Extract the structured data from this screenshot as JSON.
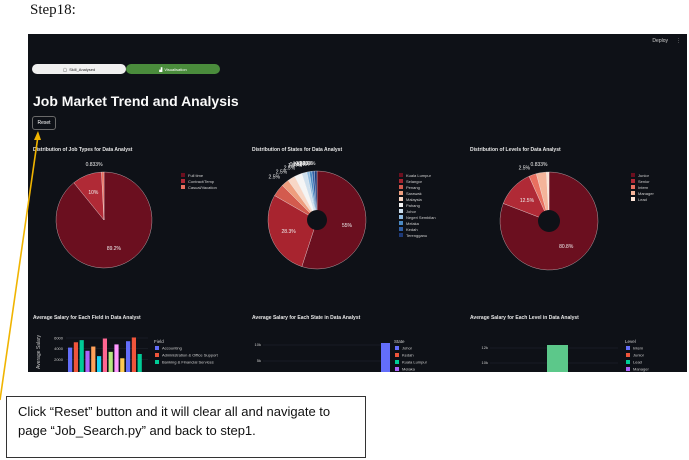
{
  "step_title": "Step18:",
  "topbar": {
    "deploy": "Deploy",
    "menu_icon": "vertical-dots-icon"
  },
  "tabs": [
    {
      "label": "Skill_Analysed"
    },
    {
      "label": "Visualisation"
    }
  ],
  "page_title": "Job Market Trend and Analysis",
  "reset_label": "Reset",
  "callout_text": "Click “Reset” button and it will clear all and navigate to page “Job_Search.py” and back to step1.",
  "colors": {
    "background": "#0e1117",
    "active_tab": "#4a8c3c",
    "arrow": "#f0b400"
  },
  "chart_data": [
    {
      "type": "pie",
      "title": "Distribution of Job Types for Data Analyst",
      "categories": [
        "Full time",
        "Contract/Temp",
        "Casual/Vacation"
      ],
      "values": [
        89.2,
        10,
        0.833
      ],
      "labels": [
        "89.2%",
        "10%",
        "0.833%"
      ],
      "colors": [
        "#6b0f1f",
        "#b02a36",
        "#e87060"
      ]
    },
    {
      "type": "pie",
      "title": "Distribution of States for Data Analyst",
      "categories": [
        "Kuala Lumpur",
        "Selangor",
        "Penang",
        "Sarawak",
        "Malaysia",
        "Pahang",
        "Johor",
        "Negeri Sembilan",
        "Melaka",
        "Kedah",
        "Terengganu"
      ],
      "values": [
        55,
        28.3,
        4.17,
        2.5,
        2.5,
        2.5,
        1.67,
        0.833,
        0.833,
        0.833,
        0.833
      ],
      "labels": [
        "55%",
        "28.3%",
        "",
        "2.5%",
        "2.5%",
        "2.5%",
        "1.67%",
        "0.833%",
        "0.833%",
        "0.833%",
        "0.833%"
      ],
      "colors": [
        "#6b0f1f",
        "#a8242f",
        "#d35b4e",
        "#ee9e7e",
        "#f8d7c6",
        "#f5f5f5",
        "#cfe0ee",
        "#90bbe0",
        "#4b8ac3",
        "#2f5fa6",
        "#1e3a78"
      ]
    },
    {
      "type": "pie",
      "title": "Distribution of Levels for Data Analyst",
      "categories": [
        "Junior",
        "Senior",
        "Intern",
        "Manager",
        "Lead"
      ],
      "values": [
        80.8,
        12.5,
        2.5,
        3.33,
        0.833
      ],
      "labels": [
        "80.8%",
        "12.5%",
        "2.5%",
        "",
        "0.833%"
      ],
      "colors": [
        "#6b0f1f",
        "#b02a36",
        "#e87060",
        "#f4b49a",
        "#fbe3d6"
      ]
    },
    {
      "type": "bar",
      "title": "Average Salary for Each Field in Data Analyst",
      "ylabel": "Average Salary",
      "yticks": [
        "2000",
        "4000",
        "6000"
      ],
      "ylim": [
        0,
        7500
      ],
      "legend_title": "Field",
      "legend": [
        "Accounting",
        "Administration & Office Support",
        "Banking & Financial Services"
      ],
      "values": [
        4200,
        5200,
        5600,
        3600,
        4400,
        2600,
        5900,
        3400,
        4800,
        2200,
        5400,
        6100,
        3000
      ],
      "colors": [
        "#636efa",
        "#ef553b",
        "#00cc96",
        "#ab63fa",
        "#ffa15a",
        "#19d3f3",
        "#ff6692",
        "#b6e880",
        "#ff97ff",
        "#fecb52",
        "#636efa",
        "#ef553b",
        "#00cc96"
      ]
    },
    {
      "type": "bar",
      "title": "Average Salary for Each State in Data Analyst",
      "ylabel": "",
      "yticks": [
        "5k",
        "10k"
      ],
      "legend_title": "State",
      "legend": [
        "Johor",
        "Kedah",
        "Kuala Lumpur",
        "Melaka"
      ],
      "colors": [
        "#636efa",
        "#ef553b",
        "#00cc96",
        "#ab63fa"
      ]
    },
    {
      "type": "bar",
      "title": "Average Salary for Each Level in Data Analyst",
      "ylabel": "",
      "yticks": [
        "10k",
        "12k"
      ],
      "legend_title": "Level",
      "legend": [
        "Intern",
        "Junior",
        "Lead",
        "Manager"
      ],
      "colors": [
        "#636efa",
        "#ef553b",
        "#00cc96",
        "#ab63fa"
      ]
    }
  ]
}
